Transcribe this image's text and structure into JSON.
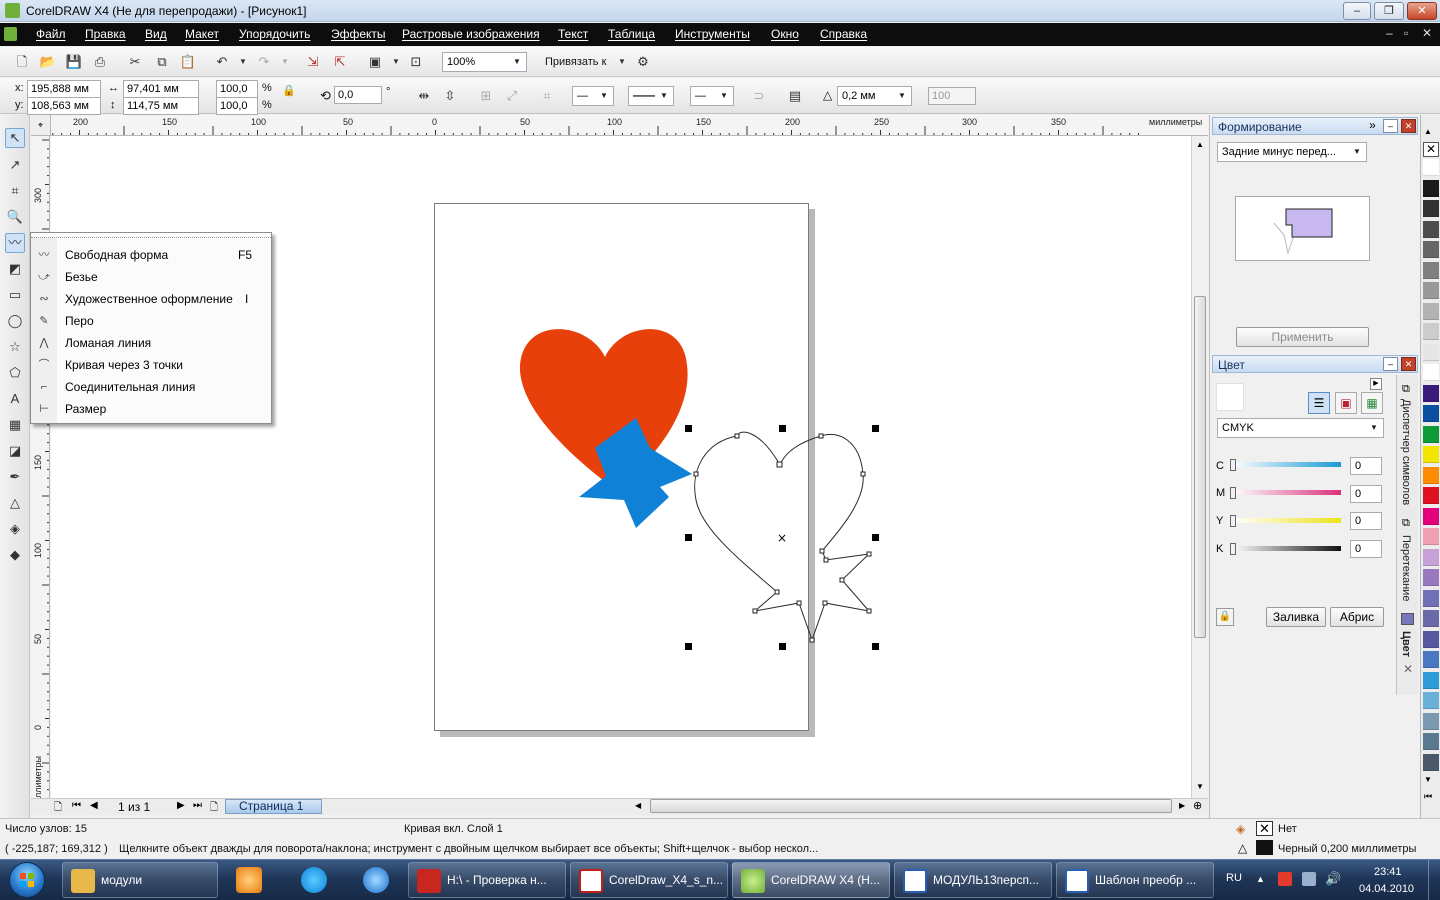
{
  "window": {
    "title": "CorelDRAW X4 (Не для перепродажи) - [Рисунок1]"
  },
  "menu": [
    {
      "label": "Файл"
    },
    {
      "label": "Правка"
    },
    {
      "label": "Вид"
    },
    {
      "label": "Макет"
    },
    {
      "label": "Упорядочить"
    },
    {
      "label": "Эффекты"
    },
    {
      "label": "Растровые изображения"
    },
    {
      "label": "Текст"
    },
    {
      "label": "Таблица"
    },
    {
      "label": "Инструменты"
    },
    {
      "label": "Окно"
    },
    {
      "label": "Справка"
    }
  ],
  "toolbar": {
    "zoom": "100%",
    "snap_label": "Привязать к"
  },
  "property_bar": {
    "x": "195,888 мм",
    "y": "108,563 мм",
    "width": "97,401 мм",
    "height": "114,75 мм",
    "scale_x": "100,0",
    "scale_y": "100,0",
    "percent": "%",
    "x_label": "x:",
    "y_label": "y:",
    "rotation": "0,0",
    "degree": "°",
    "outline_width": "0,2 мм",
    "smoothing": "100"
  },
  "rulers": {
    "top": [
      "200",
      "150",
      "100",
      "50",
      "0",
      "50",
      "100",
      "150",
      "200",
      "250",
      "300",
      "350"
    ],
    "top_unit": "миллиметры",
    "left": [
      "300",
      "250",
      "200",
      "150",
      "100",
      "50",
      "0"
    ],
    "left_unit": "миллиметры"
  },
  "flyout": [
    {
      "label": "Свободная форма",
      "shortcut": "F5",
      "icon": "freehand-icon"
    },
    {
      "label": "Безье",
      "shortcut": "",
      "icon": "bezier-icon"
    },
    {
      "label": "Художественное оформление",
      "shortcut": "I",
      "icon": "artistic-media-icon"
    },
    {
      "label": "Перо",
      "shortcut": "",
      "icon": "pen-icon"
    },
    {
      "label": "Ломаная линия",
      "shortcut": "",
      "icon": "polyline-icon"
    },
    {
      "label": "Кривая через 3 точки",
      "shortcut": "",
      "icon": "three-point-curve-icon"
    },
    {
      "label": "Соединительная линия",
      "shortcut": "",
      "icon": "connector-icon"
    },
    {
      "label": "Размер",
      "shortcut": "",
      "icon": "dimension-icon"
    }
  ],
  "page_nav": {
    "counter": "1 из 1",
    "page_tab": "Страница 1"
  },
  "shaping_docker": {
    "title": "Формирование",
    "mode": "Задние минус перед...",
    "apply": "Применить"
  },
  "color_docker": {
    "title": "Цвет",
    "model": "CMYK",
    "channels": [
      {
        "label": "C",
        "value": "0",
        "color": "#1a9ad6"
      },
      {
        "label": "M",
        "value": "0",
        "color": "#d9317a"
      },
      {
        "label": "Y",
        "value": "0",
        "color": "#ece21b"
      },
      {
        "label": "K",
        "value": "0",
        "color": "#111111"
      }
    ],
    "fill_button": "Заливка",
    "outline_button": "Абрис"
  },
  "side_tabs": {
    "char_manager": "Диспетчер символов",
    "blend": "Перетекание",
    "color": "Цвет"
  },
  "palette": [
    "#ffffff",
    "#1a1a1a",
    "#333333",
    "#4d4d4d",
    "#666666",
    "#808080",
    "#999999",
    "#b3b3b3",
    "#cccccc",
    "#e6e6e6",
    "#ffffff",
    "#3a1a7a",
    "#0b4fa1",
    "#0f9a3a",
    "#f2e600",
    "#ff8c00",
    "#e01020",
    "#e4007c",
    "#f0a0b0",
    "#c8a0d8",
    "#9a78c0",
    "#7070b8",
    "#6a6aa8",
    "#5858a0",
    "#4a78c0",
    "#2e9ad6",
    "#6ab0d8",
    "#7a9ab0",
    "#5a7a90",
    "#4a5a6a"
  ],
  "status": {
    "nodes": "Число узлов: 15",
    "object": "Кривая вкл. Слой 1",
    "coords": "( -225,187; 169,312 )",
    "hint": "Щелкните объект дважды для поворота/наклона; инструмент с двойным щелчком выбирает все объекты; Shift+щелчок - выбор нескол...",
    "fill": "Нет",
    "outline": "Черный  0,200 миллиметры"
  },
  "taskbar": {
    "items": [
      {
        "label": "модули",
        "icon": "folder-icon",
        "color": "#e8b84a"
      },
      {
        "label": "H:\\ - Проверка н...",
        "icon": "kaspersky-icon",
        "color": "#c8261f"
      },
      {
        "label": "CorelDraw_X4_s_n...",
        "icon": "pdf-icon",
        "color": "#c0201a"
      },
      {
        "label": "CorelDRAW X4 (Н...",
        "icon": "coreldraw-icon",
        "color": "#6fb03a"
      },
      {
        "label": "МОДУЛЬ13персп...",
        "icon": "word-icon",
        "color": "#2b5fb4"
      },
      {
        "label": "Шаблон преобр ...",
        "icon": "word-icon",
        "color": "#2b5fb4"
      }
    ],
    "lang": "RU",
    "time": "23:41",
    "date": "04.04.2010"
  }
}
